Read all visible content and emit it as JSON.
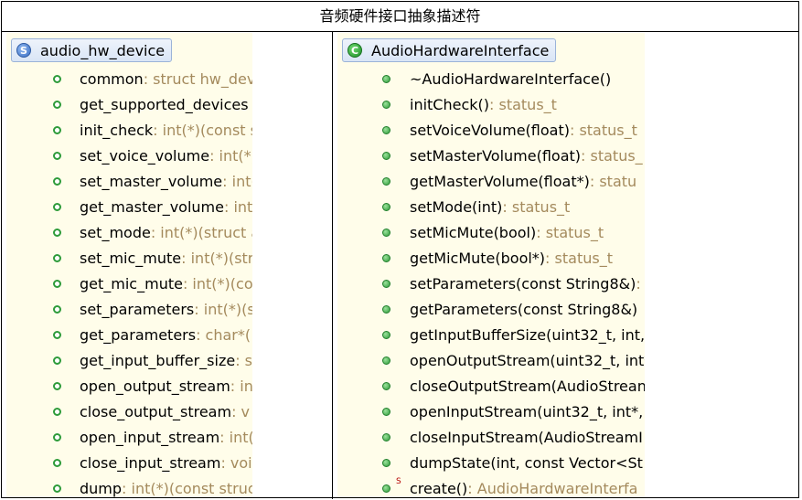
{
  "caption": "音频硬件接口抽象描述符",
  "left_panel": {
    "type_name": "audio_hw_device",
    "icon": "struct-icon",
    "badge_letter": "S",
    "members": [
      {
        "name": "common",
        "type": " : struct hw_dev",
        "icon": "field-icon"
      },
      {
        "name": "get_supported_devices",
        "type": "",
        "icon": "field-icon"
      },
      {
        "name": "init_check",
        "type": " : int(*)(const s",
        "icon": "field-icon"
      },
      {
        "name": "set_voice_volume",
        "type": " : int(*)",
        "icon": "field-icon"
      },
      {
        "name": "set_master_volume",
        "type": " : int(",
        "icon": "field-icon"
      },
      {
        "name": "get_master_volume",
        "type": " : int",
        "icon": "field-icon"
      },
      {
        "name": "set_mode",
        "type": " : int(*)(struct a",
        "icon": "field-icon"
      },
      {
        "name": "set_mic_mute",
        "type": " : int(*)(stru",
        "icon": "field-icon"
      },
      {
        "name": "get_mic_mute",
        "type": " : int(*)(co",
        "icon": "field-icon"
      },
      {
        "name": "set_parameters",
        "type": " : int(*)(s",
        "icon": "field-icon"
      },
      {
        "name": "get_parameters",
        "type": " : char*(",
        "icon": "field-icon"
      },
      {
        "name": "get_input_buffer_size",
        "type": " : s",
        "icon": "field-icon"
      },
      {
        "name": "open_output_stream",
        "type": " : in",
        "icon": "field-icon"
      },
      {
        "name": "close_output_stream",
        "type": " : v",
        "icon": "field-icon"
      },
      {
        "name": "open_input_stream",
        "type": " : int(",
        "icon": "field-icon"
      },
      {
        "name": "close_input_stream",
        "type": " : voi",
        "icon": "field-icon"
      },
      {
        "name": "dump",
        "type": " : int(*)(const struc",
        "icon": "field-icon"
      }
    ]
  },
  "right_panel": {
    "type_name": "AudioHardwareInterface",
    "icon": "class-icon",
    "badge_letter": "C",
    "members": [
      {
        "name": "~AudioHardwareInterface()",
        "type": "",
        "icon": "method-icon"
      },
      {
        "name": "initCheck()",
        "type": " : status_t",
        "icon": "method-icon"
      },
      {
        "name": "setVoiceVolume(float)",
        "type": " : status_t",
        "icon": "method-icon"
      },
      {
        "name": "setMasterVolume(float)",
        "type": " : status_",
        "icon": "method-icon"
      },
      {
        "name": "getMasterVolume(float*)",
        "type": " : statu",
        "icon": "method-icon"
      },
      {
        "name": "setMode(int)",
        "type": " : status_t",
        "icon": "method-icon"
      },
      {
        "name": "setMicMute(bool)",
        "type": " : status_t",
        "icon": "method-icon"
      },
      {
        "name": "getMicMute(bool*)",
        "type": " : status_t",
        "icon": "method-icon"
      },
      {
        "name": "setParameters(const String8&)",
        "type": " : s",
        "icon": "method-icon"
      },
      {
        "name": "getParameters(const String8&)",
        "type": "",
        "icon": "method-icon"
      },
      {
        "name": "getInputBufferSize(uint32_t, int,",
        "type": "",
        "icon": "method-icon"
      },
      {
        "name": "openOutputStream(uint32_t, int*",
        "type": "",
        "icon": "method-icon"
      },
      {
        "name": "closeOutputStream(AudioStrean",
        "type": "",
        "icon": "method-icon"
      },
      {
        "name": "openInputStream(uint32_t, int*,",
        "type": "",
        "icon": "method-icon"
      },
      {
        "name": "closeInputStream(AudioStreamI",
        "type": "",
        "icon": "method-icon"
      },
      {
        "name": "dumpState(int, const Vector<St",
        "type": "",
        "icon": "method-icon"
      },
      {
        "name": "create()",
        "type": " : AudioHardwareInterfa",
        "icon": "method-icon",
        "static_marker": "S"
      }
    ]
  },
  "colors": {
    "panel_background": "#fffdea",
    "member_type_text": "#a48a5d",
    "method_icon": "#2e9b3a",
    "static_marker": "#b30000"
  }
}
